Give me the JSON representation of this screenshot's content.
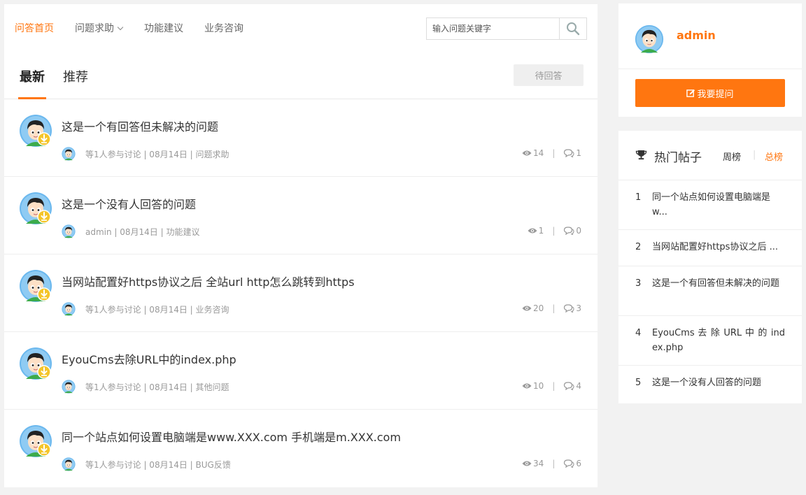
{
  "nav": {
    "items": [
      {
        "label": "问答首页",
        "active": true
      },
      {
        "label": "问题求助",
        "dropdown": true
      },
      {
        "label": "功能建议"
      },
      {
        "label": "业务咨询"
      }
    ]
  },
  "search": {
    "placeholder": "输入问题关键字",
    "icon": "search-icon"
  },
  "tabs": [
    {
      "label": "最新",
      "active": true
    },
    {
      "label": "推荐"
    }
  ],
  "wait_button": "待回答",
  "questions": [
    {
      "title": "这是一个有回答但未解决的问题",
      "meta": "等1人参与讨论 | 08月14日 | 问题求助",
      "views": "14",
      "replies": "1"
    },
    {
      "title": "这是一个没有人回答的问题",
      "meta": "admin | 08月14日 | 功能建议",
      "views": "1",
      "replies": "0"
    },
    {
      "title": "当网站配置好https协议之后 全站url http怎么跳转到https",
      "meta": "等1人参与讨论 | 08月14日 | 业务咨询",
      "views": "20",
      "replies": "3"
    },
    {
      "title": "EyouCms去除URL中的index.php",
      "meta": "等1人参与讨论 | 08月14日 | 其他问题",
      "views": "10",
      "replies": "4"
    },
    {
      "title": "同一个站点如何设置电脑端是www.XXX.com 手机端是m.XXX.com",
      "meta": "等1人参与讨论 | 08月14日 | BUG反馈",
      "views": "34",
      "replies": "6"
    }
  ],
  "user": {
    "name": "admin",
    "ask_button": "我要提问"
  },
  "hot": {
    "title": "热门帖子",
    "week": "周榜",
    "separator": "|",
    "total": "总榜",
    "items": [
      {
        "num": "1",
        "text": "同一个站点如何设置电脑端是w..."
      },
      {
        "num": "2",
        "text": "当网站配置好https协议之后 ..."
      },
      {
        "num": "3",
        "text": "这是一个有回答但未解决的问题"
      },
      {
        "num": "4",
        "text": "EyouCms 去 除 URL 中 的 index.php"
      },
      {
        "num": "5",
        "text": "这是一个没有人回答的问题"
      }
    ]
  },
  "colors": {
    "accent": "#ff7610",
    "muted": "#999999",
    "border": "#eeeeee"
  }
}
